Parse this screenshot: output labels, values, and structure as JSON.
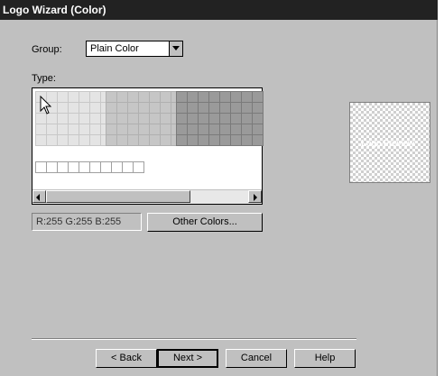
{
  "window": {
    "title": "Logo Wizard (Color)"
  },
  "group": {
    "label": "Group:",
    "selected": "Plain Color"
  },
  "type": {
    "label": "Type:"
  },
  "color_grid": {
    "block_1": {
      "rows": 5,
      "cols": 7,
      "color": "#e4e4e4"
    },
    "block_2": {
      "rows": 5,
      "cols": 7,
      "color": "#c6c6c6"
    },
    "block_3": {
      "rows": 5,
      "cols": 8,
      "color": "#9a9a9a"
    },
    "custom_swatches": 10
  },
  "rgb_readout": "R:255  G:255  B:255",
  "buttons": {
    "other_colors": "Other Colors...",
    "back": "< Back",
    "next": "Next >",
    "cancel": "Cancel",
    "help": "Help"
  },
  "colors": {
    "titlebar": "#222222",
    "dialog": "#c0c0c0"
  }
}
